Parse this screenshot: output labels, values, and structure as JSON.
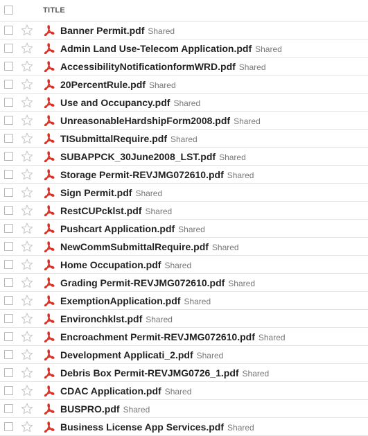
{
  "header": {
    "title": "TITLE"
  },
  "files": [
    {
      "name": "Banner Permit.pdf",
      "status": "Shared"
    },
    {
      "name": "Admin Land Use-Telecom Application.pdf",
      "status": "Shared"
    },
    {
      "name": "AccessibilityNotificationformWRD.pdf",
      "status": "Shared"
    },
    {
      "name": "20PercentRule.pdf",
      "status": "Shared"
    },
    {
      "name": "Use and Occupancy.pdf",
      "status": "Shared"
    },
    {
      "name": "UnreasonableHardshipForm2008.pdf",
      "status": "Shared"
    },
    {
      "name": "TISubmittalRequire.pdf",
      "status": "Shared"
    },
    {
      "name": "SUBAPPCK_30June2008_LST.pdf",
      "status": "Shared"
    },
    {
      "name": "Storage Permit-REVJMG072610.pdf",
      "status": "Shared"
    },
    {
      "name": "Sign Permit.pdf",
      "status": "Shared"
    },
    {
      "name": "RestCUPcklst.pdf",
      "status": "Shared"
    },
    {
      "name": "Pushcart Application.pdf",
      "status": "Shared"
    },
    {
      "name": "NewCommSubmittalRequire.pdf",
      "status": "Shared"
    },
    {
      "name": "Home Occupation.pdf",
      "status": "Shared"
    },
    {
      "name": "Grading Permit-REVJMG072610.pdf",
      "status": "Shared"
    },
    {
      "name": "ExemptionApplication.pdf",
      "status": "Shared"
    },
    {
      "name": "Environchklst.pdf",
      "status": "Shared"
    },
    {
      "name": "Encroachment Permit-REVJMG072610.pdf",
      "status": "Shared"
    },
    {
      "name": "Development Applicati_2.pdf",
      "status": "Shared"
    },
    {
      "name": "Debris Box Permit-REVJMG0726_1.pdf",
      "status": "Shared"
    },
    {
      "name": "CDAC Application.pdf",
      "status": "Shared"
    },
    {
      "name": "BUSPRO.pdf",
      "status": "Shared"
    },
    {
      "name": "Business License App Services.pdf",
      "status": "Shared"
    }
  ],
  "icons": {
    "star": "star-outline-icon",
    "file": "pdf-icon"
  },
  "colors": {
    "pdf_red": "#d93025",
    "star_gray": "#c4c4c4",
    "shared_gray": "#777777"
  }
}
